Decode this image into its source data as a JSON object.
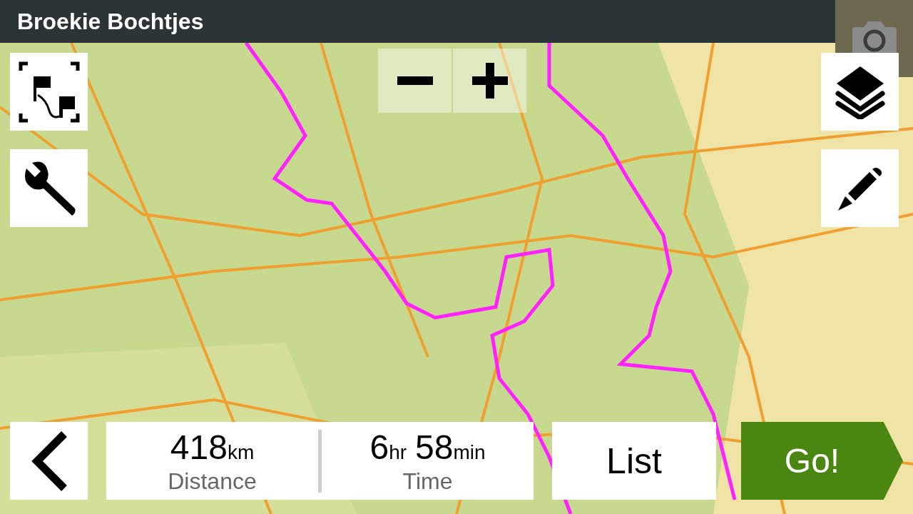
{
  "window": {
    "title": "Broekie Bochtjes"
  },
  "summary": [
    {
      "value": "418",
      "unit": "km",
      "label": "Distance"
    },
    {
      "parts": [
        {
          "value": "6",
          "unit": "hr"
        },
        {
          "value": "58",
          "unit": "min"
        }
      ],
      "label": "Time"
    }
  ],
  "buttons": {
    "list": "List",
    "go": "Go!"
  }
}
